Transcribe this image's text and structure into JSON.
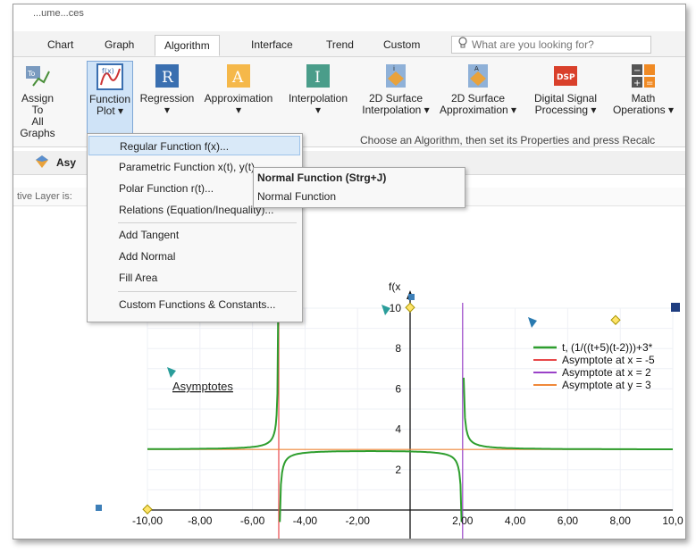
{
  "window": {
    "title_fragment": "...ume...ces"
  },
  "ribbon_tabs": [
    {
      "label": "Chart"
    },
    {
      "label": "Graph"
    },
    {
      "label": "Algorithm"
    },
    {
      "label": "Interface"
    },
    {
      "label": "Trend"
    },
    {
      "label": "Custom"
    }
  ],
  "active_tab": "Algorithm",
  "search": {
    "icon": "lightbulb-icon",
    "placeholder": "What are you looking for?"
  },
  "ribbon": {
    "buttons": [
      {
        "label1": "Assign To",
        "label2": "All Graphs",
        "icon": "assign-graphs-icon"
      },
      {
        "label1": "Function",
        "label2": "Plot ▾",
        "icon": "function-plot-icon"
      },
      {
        "label1": "Regression",
        "label2": "▾",
        "icon": "regression-icon"
      },
      {
        "label1": "Approximation",
        "label2": "▾",
        "icon": "approximation-icon"
      },
      {
        "label1": "Interpolation",
        "label2": "▾",
        "icon": "interpolation-icon"
      },
      {
        "label1": "2D Surface",
        "label2": "Interpolation ▾",
        "icon": "surface-interpolation-icon"
      },
      {
        "label1": "2D Surface",
        "label2": "Approximation ▾",
        "icon": "surface-approximation-icon"
      },
      {
        "label1": "Digital Signal",
        "label2": "Processing ▾",
        "icon": "dsp-icon"
      },
      {
        "label1": "Math",
        "label2": "Operations ▾",
        "icon": "math-operations-icon"
      }
    ],
    "hint": "Choose an Algorithm, then set its Properties and press Recalc"
  },
  "docbar": {
    "label": "Asy"
  },
  "status": {
    "text": "tive Layer is:"
  },
  "menu": {
    "items": [
      "Regular Function f(x)...",
      "Parametric Function x(t), y(t)...",
      "Polar Function r(t)...",
      "Relations (Equation/Inequality)...",
      "Add Tangent",
      "Add Normal",
      "Fill Area",
      "Custom Functions & Constants..."
    ]
  },
  "submenu": {
    "items": [
      "Normal Function (Strg+J)",
      "Normal Function"
    ]
  },
  "chart_labels": {
    "annotation": "Asymptotes",
    "y_axis_title": "f(x"
  },
  "colors": {
    "accent": "#2b7cd3",
    "selected_ribbon": "#cfe3f7",
    "menu_highlight": "#d9e9f8"
  },
  "chart_data": {
    "type": "line",
    "title": "",
    "xlim": [
      -10,
      10
    ],
    "ylim": [
      0,
      10
    ],
    "x_ticks": [
      "-10,00",
      "-8,00",
      "-6,00",
      "-4,00",
      "-2,00",
      "2,00",
      "4,00",
      "6,00",
      "8,00",
      "10,0"
    ],
    "y_ticks": [
      "2",
      "4",
      "6",
      "8",
      "10"
    ],
    "series": [
      {
        "name": "t, (1/((t+5)(t-2)))+3*",
        "color": "#2e9e2e",
        "type": "curve"
      },
      {
        "name": "Asymptote at x = -5",
        "color": "#e8484a",
        "type": "vline",
        "x": -5
      },
      {
        "name": "Asymptote at x = 2",
        "color": "#9a42c8",
        "type": "vline",
        "x": 2
      },
      {
        "name": "Asymptote at y = 3",
        "color": "#f0883a",
        "type": "hline",
        "y": 3
      }
    ]
  }
}
